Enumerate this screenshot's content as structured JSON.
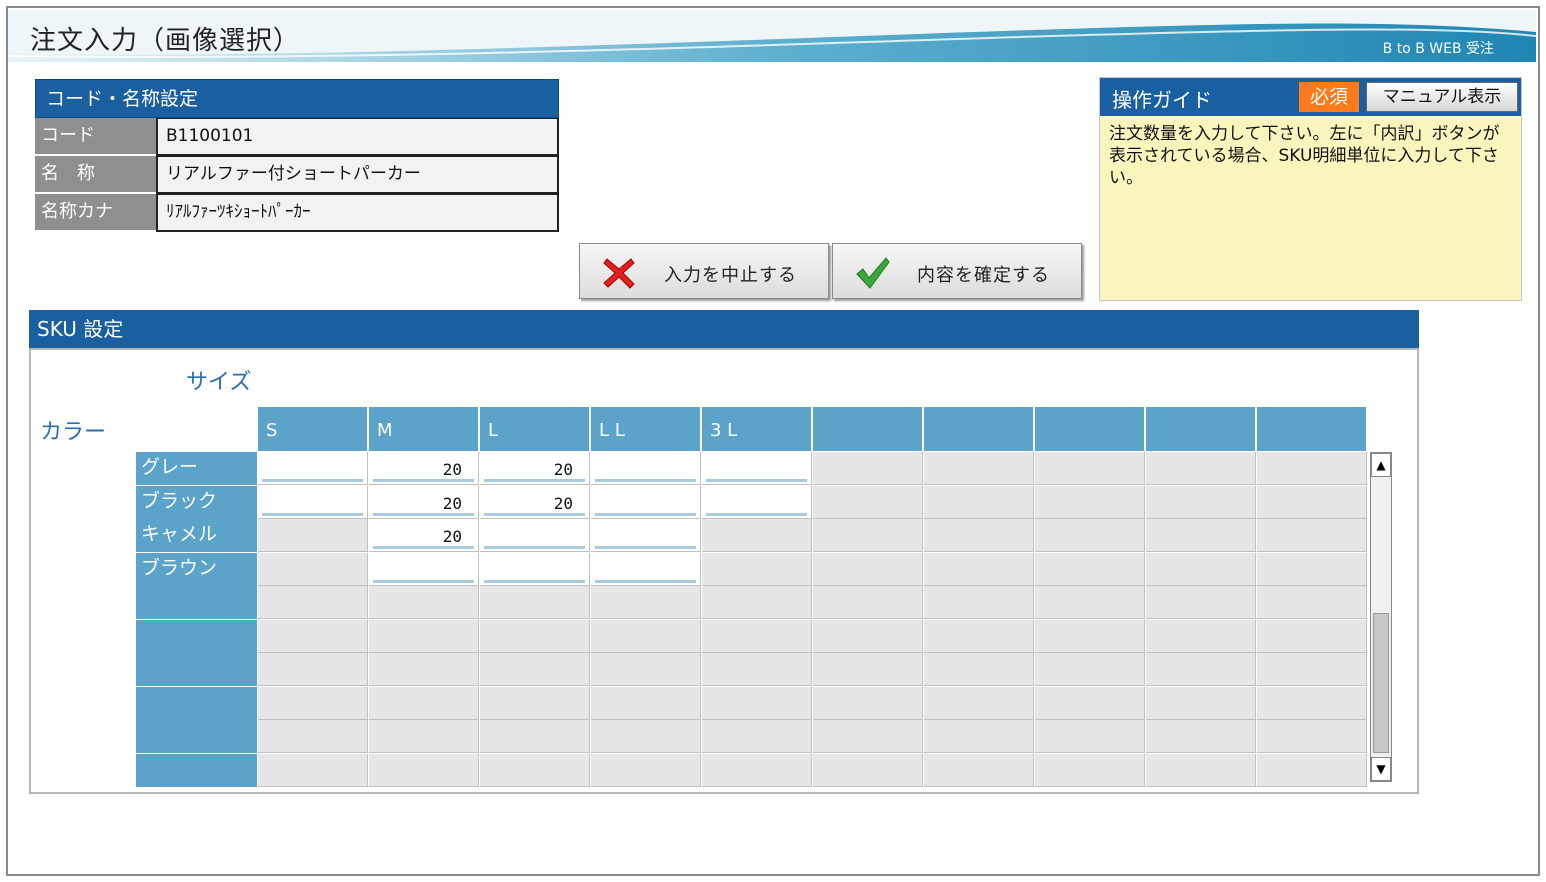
{
  "header": {
    "title": "注文入力（画像選択）",
    "brand": "B to B WEB 受注"
  },
  "code_panel": {
    "heading": "コード・名称設定",
    "rows": [
      {
        "label": "コード",
        "value": "B1100101"
      },
      {
        "label": "名　称",
        "value": "リアルファー付ショートパーカー"
      },
      {
        "label": "名称カナ",
        "value": "ﾘｱﾙﾌｧｰﾂｷｼｮｰﾄﾊﾟｰｶｰ"
      }
    ]
  },
  "actions": {
    "cancel_label": "入力を中止する",
    "confirm_label": "内容を確定する"
  },
  "guide": {
    "title": "操作ガイド",
    "required": "必須",
    "manual_button": "マニュアル表示",
    "text": "注文数量を入力して下さい。左に「内訳」ボタンが表示されている場合、SKU明細単位に入力して下さい。"
  },
  "sku": {
    "heading": "SKU 設定",
    "size_label": "サイズ",
    "color_label": "カラー",
    "sizes": [
      "S",
      "M",
      "L",
      "L L",
      "3 L",
      "",
      "",
      "",
      "",
      ""
    ],
    "colors": [
      "グレー",
      "ブラック",
      "キャメル",
      "ブラウン",
      "",
      "",
      "",
      "",
      "",
      ""
    ],
    "available": [
      [
        true,
        true,
        true,
        true,
        true,
        false,
        false,
        false,
        false,
        false
      ],
      [
        true,
        true,
        true,
        true,
        true,
        false,
        false,
        false,
        false,
        false
      ],
      [
        false,
        true,
        true,
        true,
        false,
        false,
        false,
        false,
        false,
        false
      ],
      [
        false,
        true,
        true,
        true,
        false,
        false,
        false,
        false,
        false,
        false
      ]
    ],
    "quantities": [
      [
        "",
        "20",
        "20",
        "",
        ""
      ],
      [
        "",
        "20",
        "20",
        "",
        ""
      ],
      [
        "",
        "20",
        "",
        "",
        ""
      ],
      [
        "",
        "",
        "",
        "",
        ""
      ]
    ]
  },
  "colors": {
    "primary": "#1a5fa0",
    "header_cell": "#5ba3c8",
    "guide_bg": "#faf5bd",
    "badge": "#ff7a1a"
  }
}
